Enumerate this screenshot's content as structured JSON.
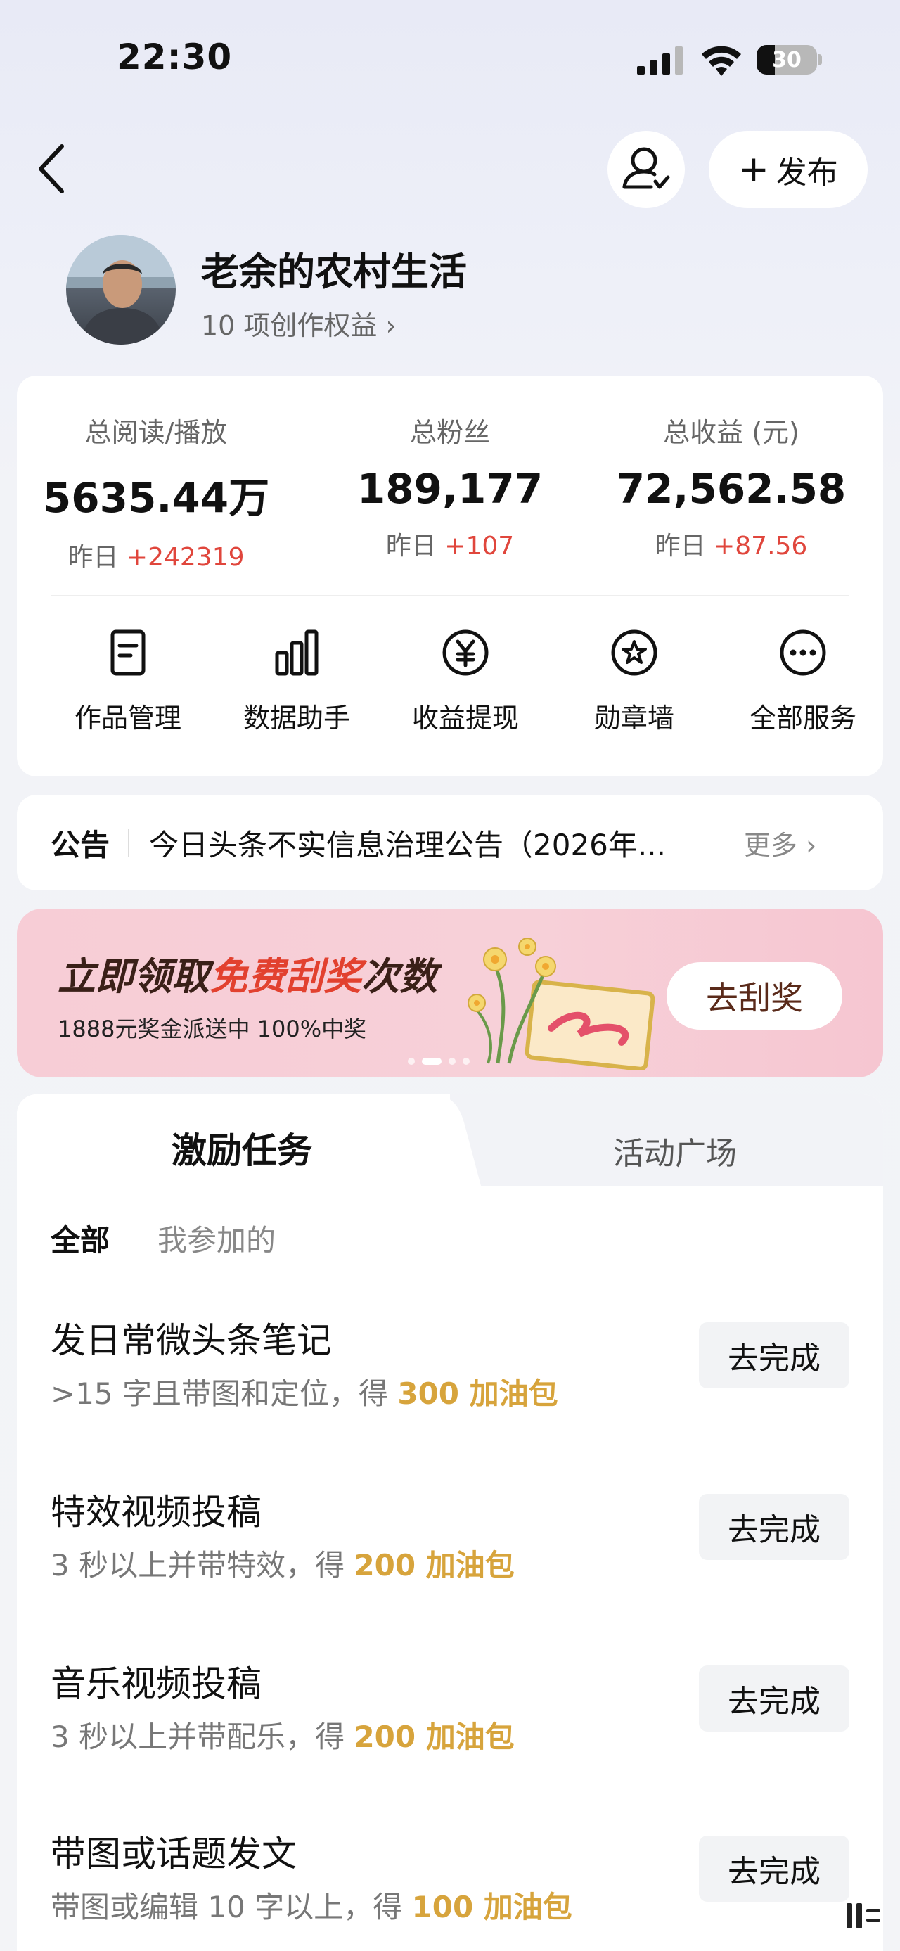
{
  "status_bar": {
    "time": "22:30",
    "battery": "30"
  },
  "nav": {
    "publish_label": "发布"
  },
  "profile": {
    "name": "老余的农村生活",
    "benefits": "10 项创作权益 ›"
  },
  "stats": [
    {
      "label": "总阅读/播放",
      "value": "5635.44万",
      "delta_prefix": "昨日 ",
      "delta": "+242319"
    },
    {
      "label": "总粉丝",
      "value": "189,177",
      "delta_prefix": "昨日 ",
      "delta": "+107"
    },
    {
      "label": "总收益 (元)",
      "value": "72,562.58",
      "delta_prefix": "昨日 ",
      "delta": "+87.56"
    }
  ],
  "services": [
    {
      "label": "作品管理",
      "icon": "document-icon"
    },
    {
      "label": "数据助手",
      "icon": "bar-chart-icon"
    },
    {
      "label": "收益提现",
      "icon": "yuan-icon"
    },
    {
      "label": "勋章墙",
      "icon": "badge-icon"
    },
    {
      "label": "全部服务",
      "icon": "more-icon"
    }
  ],
  "notice": {
    "tag": "公告",
    "text": "今日头条不实信息治理公告（2026年...",
    "more": "更多 ›"
  },
  "banner": {
    "title_a": "立即领取",
    "title_hl": "免费刮奖",
    "title_b": "次数",
    "subtitle": "1888元奖金派送中 100%中奖",
    "cta": "去刮奖"
  },
  "tabs": {
    "active": "激励任务",
    "inactive": "活动广场"
  },
  "filters": {
    "all": "全部",
    "mine": "我参加的"
  },
  "tasks": [
    {
      "title": "发日常微头条笔记",
      "desc": ">15 字且带图和定位，得 ",
      "reward": "300 加油包",
      "button": "去完成"
    },
    {
      "title": "特效视频投稿",
      "desc": "3 秒以上并带特效，得 ",
      "reward": "200 加油包",
      "button": "去完成"
    },
    {
      "title": "音乐视频投稿",
      "desc": "3 秒以上并带配乐，得 ",
      "reward": "200 加油包",
      "button": "去完成"
    },
    {
      "title": "带图或话题发文",
      "desc": "带图或编辑 10 字以上，得 ",
      "reward": "100 加油包",
      "button": "去完成"
    }
  ],
  "colors": {
    "accent_red": "#e0463c",
    "reward_gold": "#d7a43c",
    "banner_pink": "#f7cdd6"
  }
}
